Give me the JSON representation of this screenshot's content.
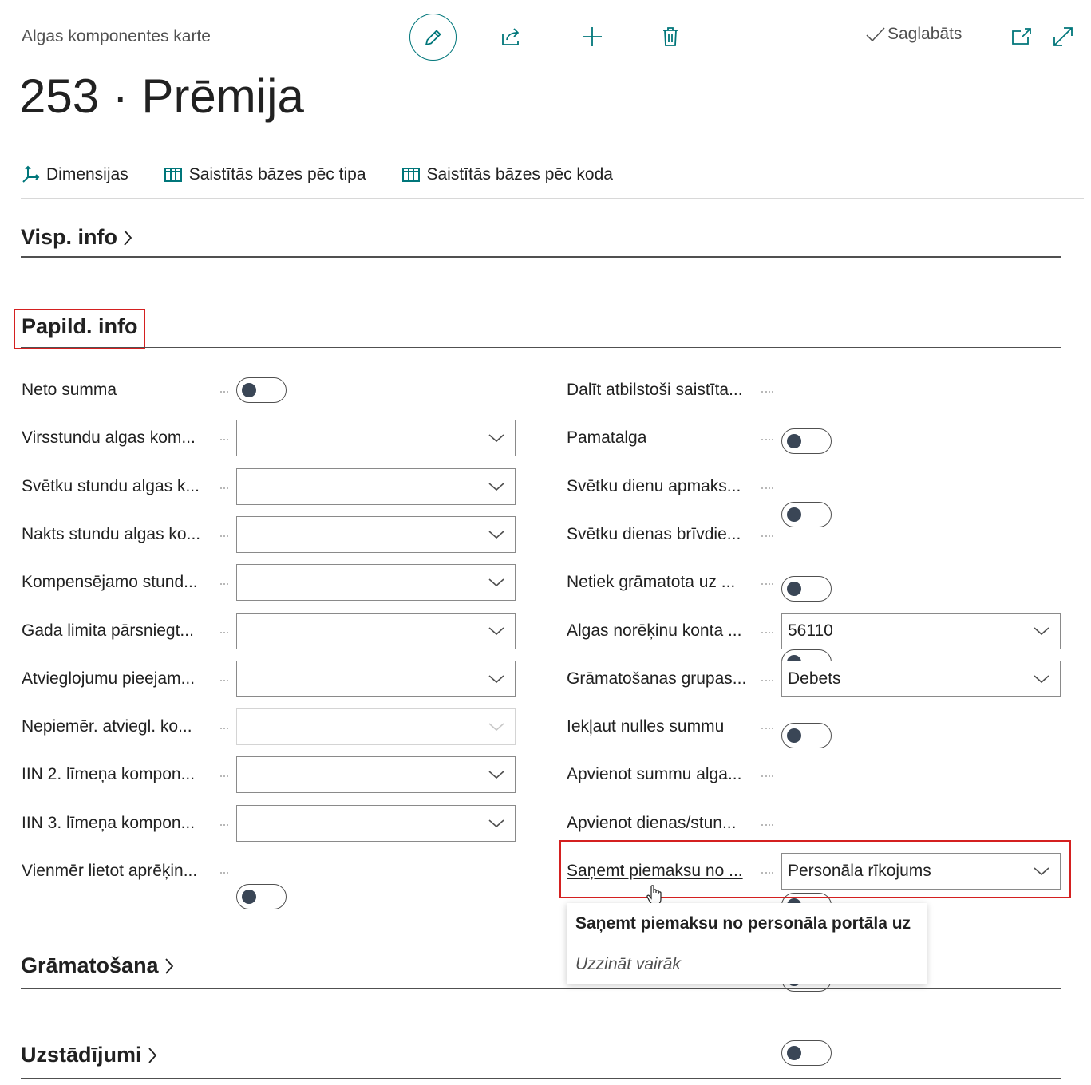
{
  "header": {
    "subtitle": "Algas komponentes karte",
    "title": "253 · Prēmija",
    "saved_label": "Saglabāts"
  },
  "toolbar": {
    "edit_icon": "pencil-icon",
    "share_icon": "share-icon",
    "new_icon": "plus-icon",
    "delete_icon": "trash-icon",
    "open_new_window_icon": "open-in-new-window-icon",
    "expand_icon": "expand-icon"
  },
  "actions": [
    {
      "label": "Dimensijas",
      "icon": "dimensions-icon"
    },
    {
      "label": "Saistītās bāzes pēc tipa",
      "icon": "table-icon"
    },
    {
      "label": "Saistītās bāzes pēc koda",
      "icon": "table-icon"
    }
  ],
  "sections": {
    "general": "Visp. info",
    "additional": "Papild. info",
    "posting": "Grāmatošana",
    "setup": "Uzstādījumi"
  },
  "left_fields": [
    {
      "label": "Neto summa",
      "type": "toggle",
      "value": false
    },
    {
      "label": "Virsstundu algas kom...",
      "type": "select",
      "value": ""
    },
    {
      "label": "Svētku stundu algas k...",
      "type": "select",
      "value": ""
    },
    {
      "label": "Nakts stundu algas ko...",
      "type": "select",
      "value": ""
    },
    {
      "label": "Kompensējamo stund...",
      "type": "select",
      "value": ""
    },
    {
      "label": "Gada limita pārsniegt...",
      "type": "select",
      "value": ""
    },
    {
      "label": "Atvieglojumu pieejam...",
      "type": "select",
      "value": ""
    },
    {
      "label": "Nepiemēr. atviegl. ko...",
      "type": "select",
      "value": "",
      "disabled": true
    },
    {
      "label": "IIN 2. līmeņa kompon...",
      "type": "select",
      "value": ""
    },
    {
      "label": "IIN 3. līmeņa kompon...",
      "type": "select",
      "value": ""
    },
    {
      "label": "Vienmēr lietot aprēķin...",
      "type": "toggle",
      "value": false
    }
  ],
  "right_fields": [
    {
      "label": "Dalīt atbilstoši saistīta...",
      "type": "toggle",
      "value": false
    },
    {
      "label": "Pamatalga",
      "type": "toggle",
      "value": false
    },
    {
      "label": "Svētku dienu apmaks...",
      "type": "toggle",
      "value": false
    },
    {
      "label": "Svētku dienas brīvdie...",
      "type": "toggle",
      "value": false
    },
    {
      "label": "Netiek grāmatota uz ...",
      "type": "toggle",
      "value": false
    },
    {
      "label": "Algas norēķinu konta ...",
      "type": "select",
      "value": "56110"
    },
    {
      "label": "Grāmatošanas grupas...",
      "type": "select",
      "value": "Debets"
    },
    {
      "label": "Iekļaut nulles summu",
      "type": "toggle",
      "value": false
    },
    {
      "label": "Apvienot summu alga...",
      "type": "toggle",
      "value": false
    },
    {
      "label": "Apvienot dienas/stun...",
      "type": "toggle",
      "value": false
    },
    {
      "label": "Saņemt piemaksu no ...",
      "type": "select",
      "value": "Personāla rīkojums"
    }
  ],
  "tooltip": {
    "text": "Saņemt piemaksu no personāla portāla uz",
    "link": "Uzzināt vairāk"
  },
  "colors": {
    "accent": "#00767a",
    "highlight": "#d42020",
    "toggle_knob": "#3a4656"
  }
}
